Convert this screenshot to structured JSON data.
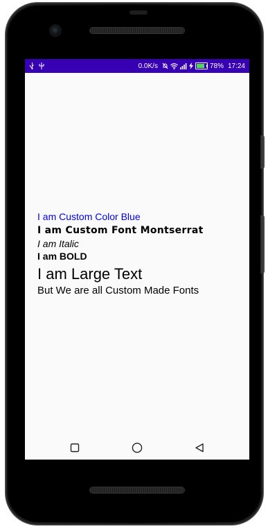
{
  "status_bar": {
    "left_icons": [
      "usb-icon",
      "usb-debug-icon"
    ],
    "network_speed": "0.0K/s",
    "battery_percent": "78%",
    "battery_level": 0.78,
    "time": "17:24",
    "background_color": "#3700b3"
  },
  "content": {
    "line1": "I am Custom Color Blue",
    "line1_color": "#0000ee",
    "line2": "I am Custom Font Montserrat",
    "line3": "I am Italic",
    "line4": "I am BOLD",
    "line5": "I am Large Text",
    "line6": "But We are all Custom  Made Fonts"
  },
  "nav_bar": {
    "buttons": [
      "recents-square-icon",
      "home-circle-icon",
      "back-triangle-icon"
    ]
  }
}
